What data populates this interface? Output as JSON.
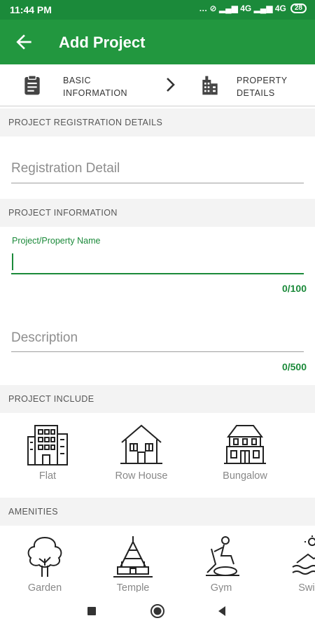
{
  "status_bar": {
    "time": "11:44 PM",
    "indicators": "… ⊘ ▂▄▆ 4G ▂▄▆ 4G",
    "battery": "28"
  },
  "app_bar": {
    "title": "Add Project",
    "back_icon": "arrow-left-icon"
  },
  "steps": [
    {
      "label": "BASIC\nINFORMATION",
      "icon": "clipboard-icon"
    },
    {
      "label": "PROPERTY\nDETAILS",
      "icon": "building-icon"
    }
  ],
  "sections": {
    "registration": "PROJECT REGISTRATION DETAILS",
    "information": "PROJECT INFORMATION",
    "include": "PROJECT INCLUDE",
    "amenities": "AMENITIES"
  },
  "fields": {
    "registration_placeholder": "Registration Detail",
    "project_name_label": "Project/Property Name",
    "project_name_value": "",
    "project_name_counter": "0/100",
    "description_placeholder": "Description",
    "description_counter": "0/500"
  },
  "project_include": [
    {
      "label": "Flat",
      "icon": "flat-building-icon"
    },
    {
      "label": "Row House",
      "icon": "row-house-icon"
    },
    {
      "label": "Bungalow",
      "icon": "bungalow-icon"
    }
  ],
  "amenities": [
    {
      "label": "Garden",
      "icon": "tree-icon"
    },
    {
      "label": "Temple",
      "icon": "temple-icon"
    },
    {
      "label": "Gym",
      "icon": "gym-icon"
    },
    {
      "label": "Swim",
      "icon": "swimming-icon"
    }
  ],
  "colors": {
    "primary": "#22973f",
    "status_bar": "#1b8a3a",
    "accent_text": "#1b8a3a",
    "section_bg": "#f3f3f3"
  }
}
